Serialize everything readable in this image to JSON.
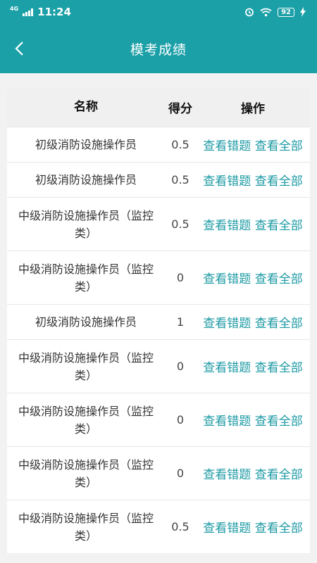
{
  "status_bar": {
    "network": "4G",
    "time": "11:24",
    "battery": "92"
  },
  "nav": {
    "title": "模考成绩"
  },
  "table": {
    "headers": {
      "name": "名称",
      "score": "得分",
      "ops": "操作"
    },
    "op_labels": {
      "wrong": "查看错题",
      "all": "查看全部"
    },
    "rows": [
      {
        "name": "初级消防设施操作员",
        "score": "0.5"
      },
      {
        "name": "初级消防设施操作员",
        "score": "0.5"
      },
      {
        "name": "中级消防设施操作员（监控类）",
        "score": "0.5"
      },
      {
        "name": "中级消防设施操作员（监控类）",
        "score": "0"
      },
      {
        "name": "初级消防设施操作员",
        "score": "1"
      },
      {
        "name": "中级消防设施操作员（监控类）",
        "score": "0"
      },
      {
        "name": "中级消防设施操作员（监控类）",
        "score": "0"
      },
      {
        "name": "中级消防设施操作员（监控类）",
        "score": "0"
      },
      {
        "name": "中级消防设施操作员（监控类）",
        "score": "0.5"
      }
    ]
  },
  "colors": {
    "header_bg": "#1ca0a8",
    "link": "#1c9aa4"
  }
}
